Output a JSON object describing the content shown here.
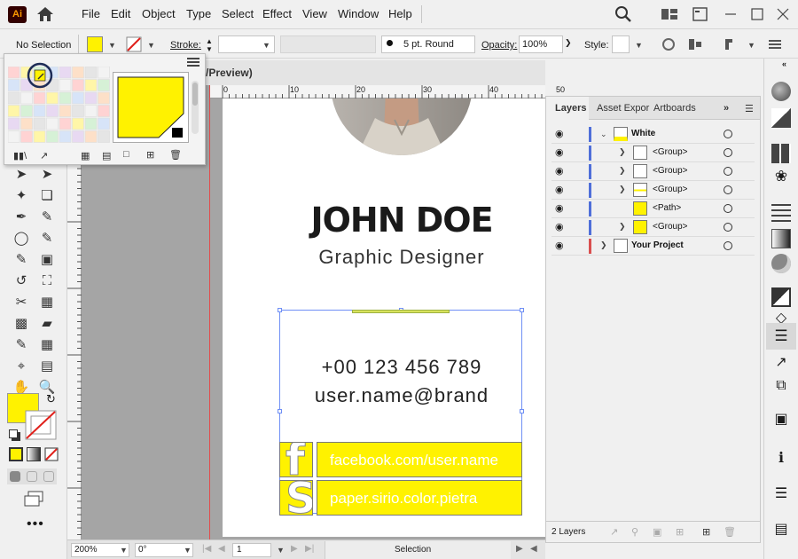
{
  "app": {
    "logo": "Ai"
  },
  "menu": [
    "File",
    "Edit",
    "Object",
    "Type",
    "Select",
    "Effect",
    "View",
    "Window",
    "Help"
  ],
  "control_bar": {
    "selection_label": "No Selection",
    "stroke_label": "Stroke:",
    "brush_value": "5 pt. Round",
    "opacity_label": "Opacity:",
    "opacity_value": "100%",
    "style_label": "Style:"
  },
  "document": {
    "tab_label": "/Preview)",
    "ruler_ticks": [
      "0",
      "10",
      "20",
      "30",
      "40",
      "50"
    ]
  },
  "card": {
    "name": "JOHN DOE",
    "role": "Graphic Designer",
    "phone": "+00 123 456 789",
    "email": "user.name@brand",
    "social": [
      {
        "glyph": "f",
        "text": "facebook.com/user.name"
      },
      {
        "glyph": "S",
        "text": "paper.sirio.color.pietra"
      }
    ],
    "accent_color": "#fff200"
  },
  "status_bar": {
    "zoom": "200%",
    "rotation": "0°",
    "artboard_index": "1",
    "tool_state": "Selection"
  },
  "layers_panel": {
    "tabs": [
      "Layers",
      "Asset Expor",
      "Artboards"
    ],
    "rows": [
      {
        "name": "White",
        "bold": true
      },
      {
        "name": "<Group>"
      },
      {
        "name": "<Group>"
      },
      {
        "name": "<Group>"
      },
      {
        "name": "<Path>"
      },
      {
        "name": "<Group>"
      },
      {
        "name": "Your Project",
        "bold": true
      }
    ],
    "footer": "2 Layers"
  }
}
